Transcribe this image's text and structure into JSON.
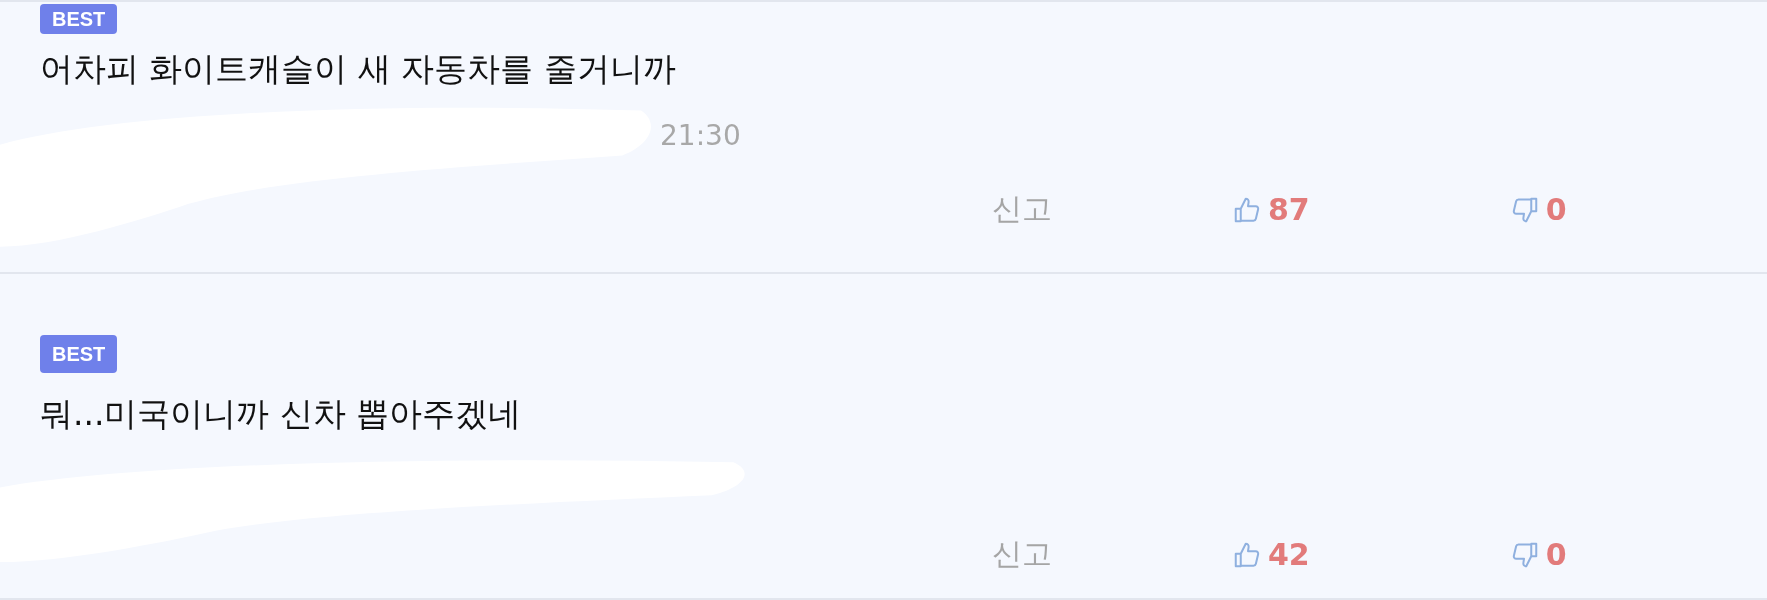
{
  "comments": [
    {
      "badge": "BEST",
      "text": "어차피 화이트캐슬이 새 자동차를 줄거니까",
      "meta": "21:30",
      "report": "신고",
      "likes": "87",
      "dislikes": "0"
    },
    {
      "badge": "BEST",
      "text": "뭐...미국이니까 신차 뽑아주겠네",
      "report": "신고",
      "likes": "42",
      "dislikes": "0"
    }
  ]
}
